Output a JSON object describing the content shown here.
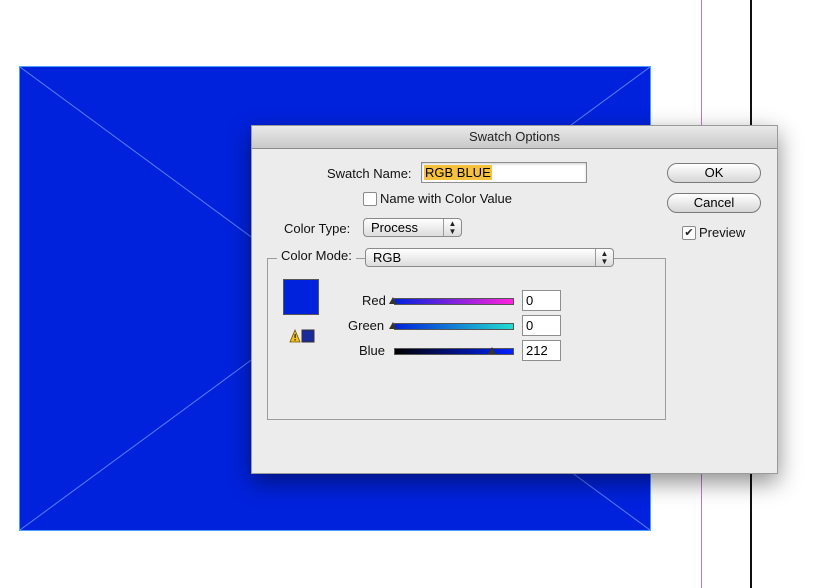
{
  "dialog": {
    "title": "Swatch Options",
    "swatch_name_label": "Swatch Name:",
    "swatch_name_value": "RGB BLUE",
    "name_with_color_value_label": "Name with Color Value",
    "name_with_color_value_checked": false,
    "color_type_label": "Color Type:",
    "color_type_value": "Process",
    "color_mode_label": "Color Mode:",
    "color_mode_value": "RGB",
    "sliders": [
      {
        "label": "Red",
        "value": "0"
      },
      {
        "label": "Green",
        "value": "0"
      },
      {
        "label": "Blue",
        "value": "212"
      }
    ],
    "ok_label": "OK",
    "cancel_label": "Cancel",
    "preview_label": "Preview",
    "preview_checked": true
  },
  "icons": {
    "popup_arrows": "up-down-arrows-icon",
    "gamut_warning": "warning-icon",
    "checkmark": "checkmark-icon"
  },
  "colors": {
    "swatch": "#0022dd",
    "selection_highlight": "#f6c23e",
    "guide_magenta": "#c07ad0"
  }
}
